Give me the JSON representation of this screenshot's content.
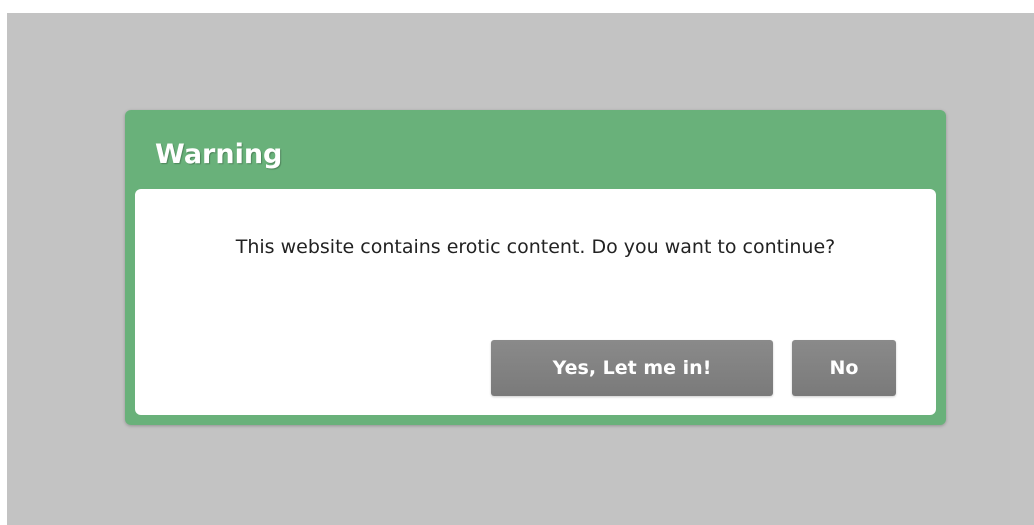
{
  "dialog": {
    "title": "Warning",
    "message": "This website contains erotic content. Do you want to continue?",
    "buttons": {
      "yes_label": "Yes, Let me in!",
      "no_label": "No"
    }
  },
  "colors": {
    "overlay": "#c3c3c3",
    "dialog_frame": "#69b17a",
    "dialog_body": "#ffffff",
    "button": "#828282",
    "button_text": "#ffffff"
  }
}
